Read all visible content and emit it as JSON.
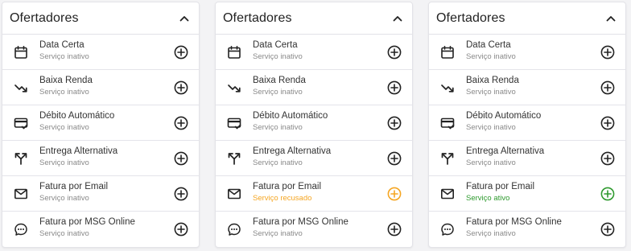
{
  "panels": [
    {
      "title": "Ofertadores",
      "items": [
        {
          "name": "Data Certa",
          "status": "Serviço inativo",
          "status_color": "#8a8a8a",
          "add_color": "#222222"
        },
        {
          "name": "Baixa Renda",
          "status": "Serviço inativo",
          "status_color": "#8a8a8a",
          "add_color": "#222222"
        },
        {
          "name": "Débito Automático",
          "status": "Serviço inativo",
          "status_color": "#8a8a8a",
          "add_color": "#222222"
        },
        {
          "name": "Entrega Alternativa",
          "status": "Serviço inativo",
          "status_color": "#8a8a8a",
          "add_color": "#222222"
        },
        {
          "name": "Fatura por Email",
          "status": "Serviço inativo",
          "status_color": "#8a8a8a",
          "add_color": "#222222"
        },
        {
          "name": "Fatura por MSG Online",
          "status": "Serviço inativo",
          "status_color": "#8a8a8a",
          "add_color": "#222222"
        }
      ]
    },
    {
      "title": "Ofertadores",
      "items": [
        {
          "name": "Data Certa",
          "status": "Serviço inativo",
          "status_color": "#8a8a8a",
          "add_color": "#222222"
        },
        {
          "name": "Baixa Renda",
          "status": "Serviço inativo",
          "status_color": "#8a8a8a",
          "add_color": "#222222"
        },
        {
          "name": "Débito Automático",
          "status": "Serviço inativo",
          "status_color": "#8a8a8a",
          "add_color": "#222222"
        },
        {
          "name": "Entrega Alternativa",
          "status": "Serviço inativo",
          "status_color": "#8a8a8a",
          "add_color": "#222222"
        },
        {
          "name": "Fatura por Email",
          "status": "Serviço recusado",
          "status_color": "#f5a623",
          "add_color": "#f5a623"
        },
        {
          "name": "Fatura por MSG Online",
          "status": "Serviço inativo",
          "status_color": "#8a8a8a",
          "add_color": "#222222"
        }
      ]
    },
    {
      "title": "Ofertadores",
      "items": [
        {
          "name": "Data Certa",
          "status": "Serviço inativo",
          "status_color": "#8a8a8a",
          "add_color": "#222222"
        },
        {
          "name": "Baixa Renda",
          "status": "Serviço inativo",
          "status_color": "#8a8a8a",
          "add_color": "#222222"
        },
        {
          "name": "Débito Automático",
          "status": "Serviço inativo",
          "status_color": "#8a8a8a",
          "add_color": "#222222"
        },
        {
          "name": "Entrega Alternativa",
          "status": "Serviço inativo",
          "status_color": "#8a8a8a",
          "add_color": "#222222"
        },
        {
          "name": "Fatura por Email",
          "status": "Serviço ativo",
          "status_color": "#2e9a2e",
          "add_color": "#2e9a2e"
        },
        {
          "name": "Fatura por MSG Online",
          "status": "Serviço inativo",
          "status_color": "#8a8a8a",
          "add_color": "#222222"
        }
      ]
    }
  ],
  "icons": [
    "calendar-icon",
    "trending-down-icon",
    "credit-card-check-icon",
    "split-arrows-icon",
    "mail-icon",
    "chat-bubble-icon"
  ]
}
